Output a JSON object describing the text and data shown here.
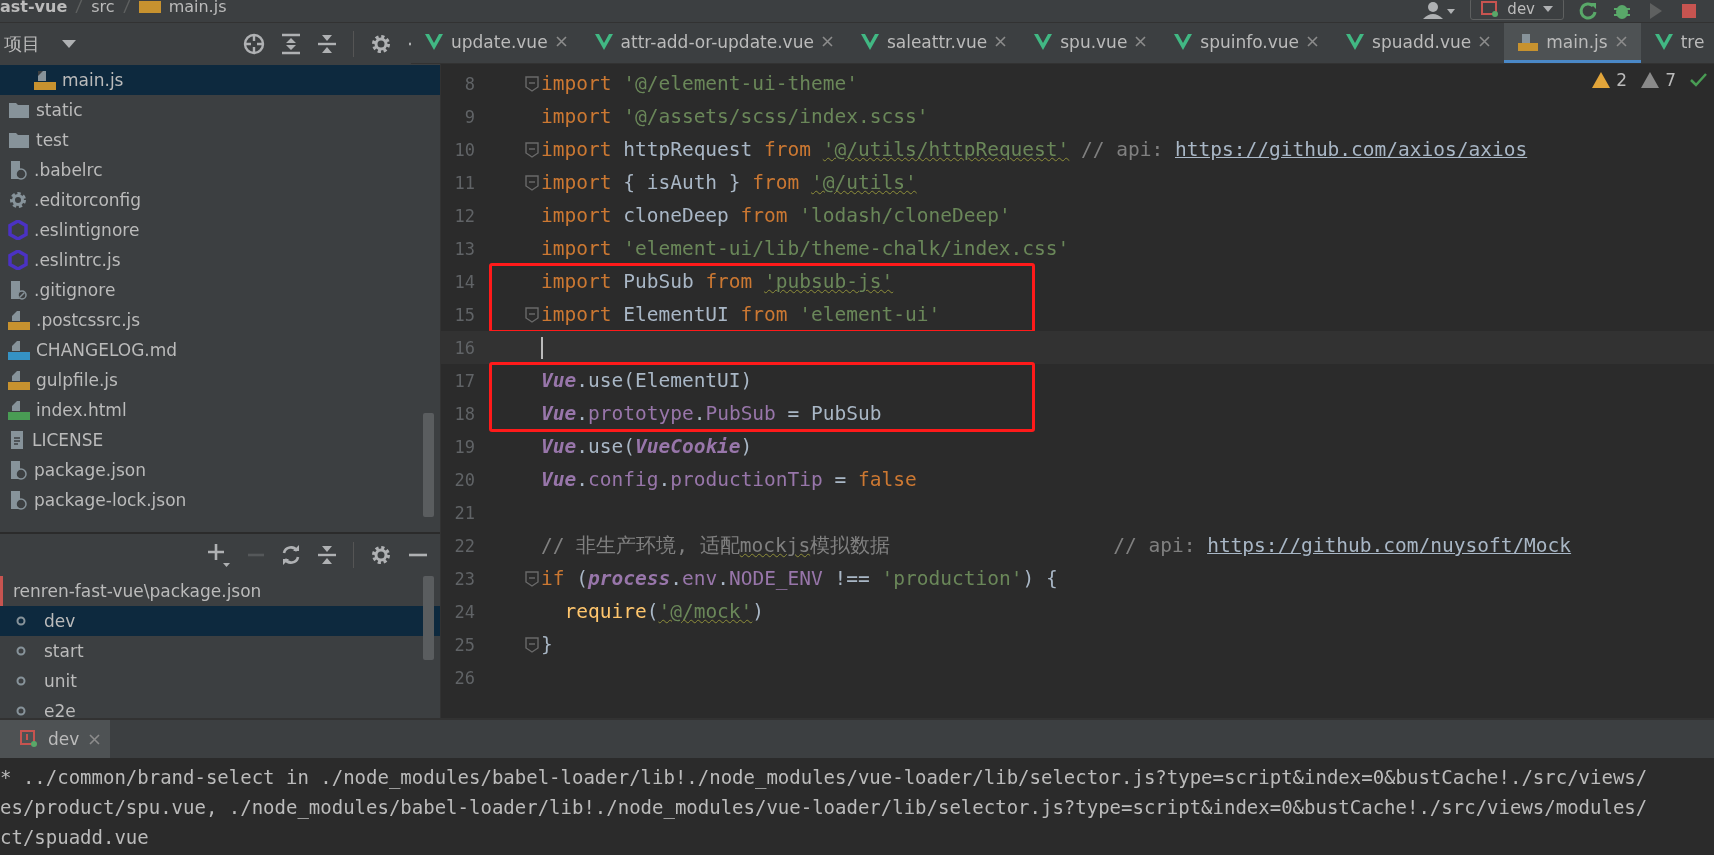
{
  "breadcrumb": [
    "ast-vue",
    "src",
    "main.js"
  ],
  "toolbar": {
    "run_config": "dev"
  },
  "project_panel": {
    "title": "项目",
    "items": [
      {
        "children": [
          {
            "name": "main.js",
            "kind": "js",
            "selected": true
          }
        ]
      },
      {
        "name": "static",
        "kind": "folder",
        "selected": false
      },
      {
        "name": "test",
        "kind": "folder",
        "selected": false
      },
      {
        "name": ".babelrc",
        "kind": "config",
        "selected": false
      },
      {
        "name": ".editorconfig",
        "kind": "gear",
        "selected": false
      },
      {
        "name": ".eslintignore",
        "kind": "eslint",
        "selected": false
      },
      {
        "name": ".eslintrc.js",
        "kind": "eslint",
        "selected": false
      },
      {
        "name": ".gitignore",
        "kind": "ignore",
        "selected": false
      },
      {
        "name": ".postcssrc.js",
        "kind": "js",
        "selected": false
      },
      {
        "name": "CHANGELOG.md",
        "kind": "md",
        "selected": false
      },
      {
        "name": "gulpfile.js",
        "kind": "js",
        "selected": false
      },
      {
        "name": "index.html",
        "kind": "html",
        "selected": false
      },
      {
        "name": "LICENSE",
        "kind": "text",
        "selected": false
      },
      {
        "name": "package.json",
        "kind": "config",
        "selected": false
      },
      {
        "name": "package-lock.json",
        "kind": "config",
        "selected": false
      }
    ]
  },
  "npm_panel": {
    "root": {
      "name": "renren-fast-vue\\package.json",
      "children": [
        {
          "name": "dev",
          "selected": true
        },
        {
          "name": "start",
          "selected": false
        },
        {
          "name": "unit",
          "selected": false
        },
        {
          "name": "e2e",
          "selected": false
        }
      ]
    }
  },
  "editor": {
    "tabs": [
      {
        "label": "update.vue",
        "kind": "vue",
        "selected": false,
        "closable": true
      },
      {
        "label": "attr-add-or-update.vue",
        "kind": "vue",
        "selected": false,
        "closable": true
      },
      {
        "label": "saleattr.vue",
        "kind": "vue",
        "selected": false,
        "closable": true
      },
      {
        "label": "spu.vue",
        "kind": "vue",
        "selected": false,
        "closable": true
      },
      {
        "label": "spuinfo.vue",
        "kind": "vue",
        "selected": false,
        "closable": true
      },
      {
        "label": "spuadd.vue",
        "kind": "vue",
        "selected": false,
        "closable": true
      },
      {
        "label": "main.js",
        "kind": "js",
        "selected": true,
        "closable": true
      },
      {
        "label": "tre",
        "kind": "vue",
        "selected": false,
        "closable": false
      }
    ],
    "inspections": {
      "warnings": "2",
      "weak_warnings": "7"
    },
    "lines": [
      {
        "n": "8",
        "fold": true,
        "boxed": false,
        "current": false,
        "tokens": [
          {
            "kind": "kw",
            "text": "import "
          },
          {
            "kind": "str",
            "text": "'@/element-ui-theme'"
          }
        ]
      },
      {
        "n": "9",
        "fold": false,
        "boxed": false,
        "current": false,
        "tokens": [
          {
            "kind": "kw",
            "text": "import "
          },
          {
            "kind": "str",
            "text": "'@/assets/scss/index.scss'"
          }
        ]
      },
      {
        "n": "10",
        "fold": true,
        "boxed": false,
        "current": false,
        "tokens": [
          {
            "kind": "kw",
            "text": "import "
          },
          {
            "kind": "plain",
            "text": "httpRequest "
          },
          {
            "kind": "kw",
            "text": "from "
          },
          {
            "kind": "str-warn",
            "text": "'@/utils/httpRequest'"
          },
          {
            "kind": "comment",
            "text": " // api: "
          },
          {
            "kind": "link",
            "text": "https://github.com/axios/axios"
          }
        ]
      },
      {
        "n": "11",
        "fold": true,
        "boxed": false,
        "current": false,
        "tokens": [
          {
            "kind": "kw",
            "text": "import "
          },
          {
            "kind": "plain",
            "text": "{ isAuth } "
          },
          {
            "kind": "kw",
            "text": "from "
          },
          {
            "kind": "str-warn",
            "text": "'@/utils'"
          }
        ]
      },
      {
        "n": "12",
        "fold": false,
        "boxed": false,
        "current": false,
        "tokens": [
          {
            "kind": "kw",
            "text": "import "
          },
          {
            "kind": "plain",
            "text": "cloneDeep "
          },
          {
            "kind": "kw",
            "text": "from "
          },
          {
            "kind": "str",
            "text": "'lodash/cloneDeep'"
          }
        ]
      },
      {
        "n": "13",
        "fold": false,
        "boxed": false,
        "current": false,
        "tokens": [
          {
            "kind": "kw",
            "text": "import "
          },
          {
            "kind": "str",
            "text": "'element-ui/lib/theme-chalk/index.css'"
          }
        ]
      },
      {
        "n": "14",
        "fold": false,
        "boxed": true,
        "current": false,
        "tokens": [
          {
            "kind": "kw",
            "text": "import "
          },
          {
            "kind": "plain",
            "text": "PubSub "
          },
          {
            "kind": "kw",
            "text": "from "
          },
          {
            "kind": "str-warn",
            "text": "'pubsub-js'"
          }
        ]
      },
      {
        "n": "15",
        "fold": true,
        "boxed": true,
        "current": false,
        "tokens": [
          {
            "kind": "kw",
            "text": "import "
          },
          {
            "kind": "plain",
            "text": "ElementUI "
          },
          {
            "kind": "kw",
            "text": "from "
          },
          {
            "kind": "str",
            "text": "'element-ui'"
          }
        ]
      },
      {
        "n": "16",
        "fold": false,
        "boxed": false,
        "current": true
      },
      {
        "n": "17",
        "fold": false,
        "boxed": true,
        "current": false,
        "tokens": [
          {
            "kind": "obj",
            "text": "Vue"
          },
          {
            "kind": "plain",
            "text": ".use(ElementUI)"
          }
        ]
      },
      {
        "n": "18",
        "fold": false,
        "boxed": true,
        "current": false,
        "tokens": [
          {
            "kind": "obj",
            "text": "Vue"
          },
          {
            "kind": "plain",
            "text": "."
          },
          {
            "kind": "prop",
            "text": "prototype"
          },
          {
            "kind": "plain",
            "text": "."
          },
          {
            "kind": "prop",
            "text": "PubSub"
          },
          {
            "kind": "plain",
            "text": " = PubSub"
          }
        ]
      },
      {
        "n": "19",
        "fold": false,
        "boxed": false,
        "current": false,
        "tokens": [
          {
            "kind": "obj",
            "text": "Vue"
          },
          {
            "kind": "plain",
            "text": ".use("
          },
          {
            "kind": "obj",
            "text": "VueCookie"
          },
          {
            "kind": "plain",
            "text": ")"
          }
        ]
      },
      {
        "n": "20",
        "fold": false,
        "boxed": false,
        "current": false,
        "tokens": [
          {
            "kind": "obj",
            "text": "Vue"
          },
          {
            "kind": "plain",
            "text": "."
          },
          {
            "kind": "prop",
            "text": "config"
          },
          {
            "kind": "plain",
            "text": "."
          },
          {
            "kind": "prop",
            "text": "productionTip"
          },
          {
            "kind": "plain",
            "text": " = "
          },
          {
            "kind": "kw",
            "text": "false"
          }
        ]
      },
      {
        "n": "21",
        "fold": false,
        "boxed": false,
        "current": false
      },
      {
        "n": "22",
        "fold": false,
        "boxed": false,
        "current": false,
        "tokens": [
          {
            "kind": "comment",
            "text": "// 非生产环境, 适配"
          },
          {
            "kind": "comment-warn",
            "text": "mockjs"
          },
          {
            "kind": "comment",
            "text": "模拟数据                   // api: "
          },
          {
            "kind": "link",
            "text": "https://github.com/nuysoft/Mock"
          }
        ]
      },
      {
        "n": "23",
        "fold": true,
        "boxed": false,
        "current": false,
        "tokens": [
          {
            "kind": "kw",
            "text": "if "
          },
          {
            "kind": "plain",
            "text": "("
          },
          {
            "kind": "obj",
            "text": "process"
          },
          {
            "kind": "plain",
            "text": "."
          },
          {
            "kind": "prop",
            "text": "env"
          },
          {
            "kind": "plain",
            "text": "."
          },
          {
            "kind": "prop",
            "text": "NODE_ENV"
          },
          {
            "kind": "plain",
            "text": " !== "
          },
          {
            "kind": "str",
            "text": "'production'"
          },
          {
            "kind": "plain",
            "text": ") {"
          }
        ]
      },
      {
        "n": "24",
        "fold": false,
        "boxed": false,
        "current": false,
        "tokens": [
          {
            "kind": "fn",
            "text": "  require"
          },
          {
            "kind": "plain",
            "text": "("
          },
          {
            "kind": "str-warn",
            "text": "'@/mock'"
          },
          {
            "kind": "plain",
            "text": ")"
          }
        ]
      },
      {
        "n": "25",
        "fold": true,
        "boxed": false,
        "current": false,
        "tokens": [
          {
            "kind": "plain",
            "text": "}"
          }
        ]
      },
      {
        "n": "26",
        "fold": false,
        "boxed": false,
        "current": false
      }
    ]
  },
  "run_window": {
    "tab": {
      "label": "dev",
      "selected": true
    },
    "lines": [
      "* ../common/brand-select in ./node_modules/babel-loader/lib!./node_modules/vue-loader/lib/selector.js?type=script&index=0&bustCache!./src/views/",
      "es/product/spu.vue, ./node_modules/babel-loader/lib!./node_modules/vue-loader/lib/selector.js?type=script&index=0&bustCache!./src/views/modules/",
      "ct/spuadd.vue"
    ]
  }
}
